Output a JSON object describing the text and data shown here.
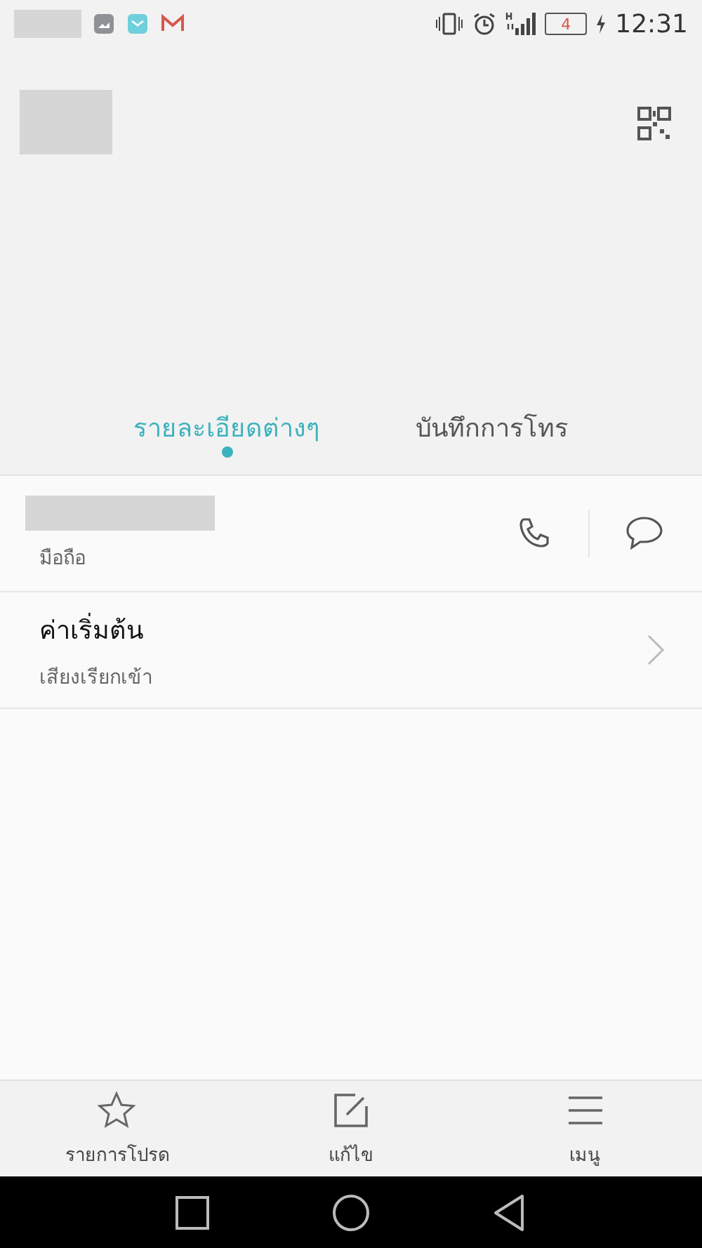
{
  "status_bar": {
    "battery": "4",
    "time": "12:31"
  },
  "tabs": [
    {
      "label": "รายละเอียดต่างๆ",
      "selected": true
    },
    {
      "label": "บันทึกการโทร",
      "selected": false
    }
  ],
  "phone_entry": {
    "label": "มือถือ"
  },
  "ringtone": {
    "title": "ค่าเริ่มต้น",
    "subtitle": "เสียงเรียกเข้า"
  },
  "bottom_bar": [
    {
      "kind": "star",
      "label": "รายการโปรด"
    },
    {
      "kind": "edit",
      "label": "แก้ไข"
    },
    {
      "kind": "menu",
      "label": "เมนู"
    }
  ]
}
